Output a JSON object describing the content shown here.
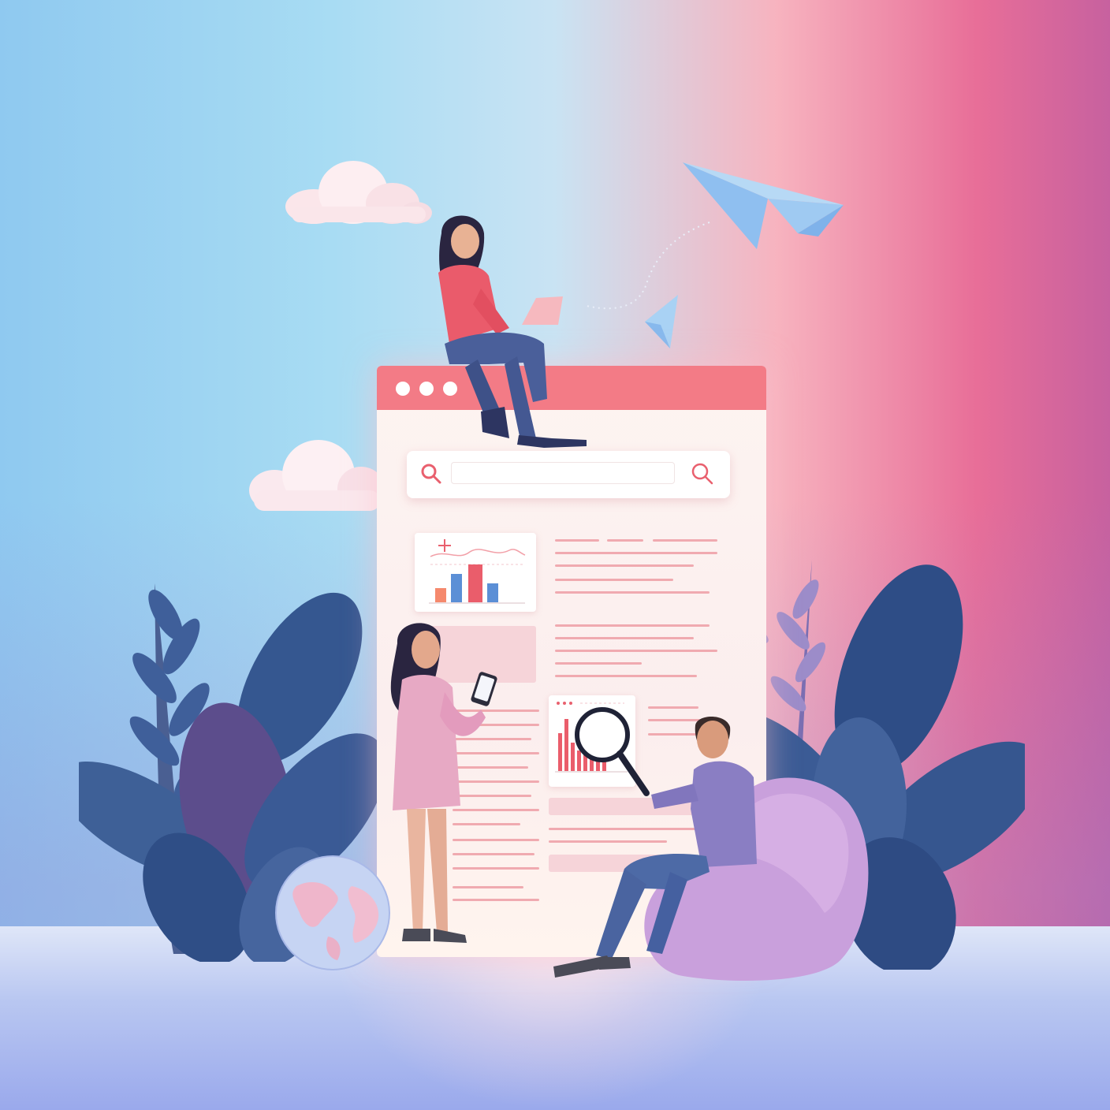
{
  "scene": {
    "background_left": "#8fc9f0",
    "background_right": "#e86e98",
    "floor_color": "#b9c7f1"
  },
  "browser_window": {
    "titlebar_color": "#f37b86",
    "window_dots": 3,
    "search": {
      "left_icon": "search-icon",
      "right_icon": "search-icon",
      "placeholder": ""
    },
    "chart_card_top": {
      "icon": "sparkle-icon",
      "bar_colors": [
        "#f5896d",
        "#5b8fd6",
        "#ea5d6b",
        "#5b8fd6"
      ]
    },
    "chart_card_bottom": {
      "bar_color": "#ea5d6b"
    }
  },
  "figures": {
    "top": "woman-with-laptop",
    "standing": "woman-with-phone",
    "sitting": "man-with-magnifier"
  },
  "decor": [
    "cloud",
    "cloud",
    "paper-plane",
    "paper-plane",
    "globe",
    "beanbag",
    "plant-left",
    "plant-right"
  ]
}
